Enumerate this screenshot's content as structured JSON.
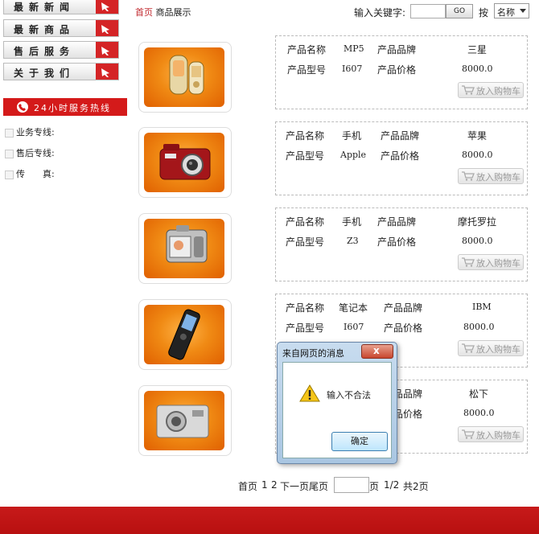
{
  "sidebar": {
    "items": [
      {
        "label": "最新新闻"
      },
      {
        "label": "最新商品"
      },
      {
        "label": "售后服务"
      },
      {
        "label": "关于我们"
      }
    ],
    "hotline": "24小时服务热线",
    "contacts": [
      {
        "label": "业务专线:"
      },
      {
        "label": "售后专线:"
      },
      {
        "label": "传　　真:"
      }
    ]
  },
  "breadcrumb": {
    "home": "首页",
    "current": "商品展示"
  },
  "search": {
    "label": "输入关键字:",
    "value": "",
    "go": "GO",
    "by": "按",
    "field_selected": "名称"
  },
  "product_labels": {
    "name": "产品名称",
    "brand": "产品品牌",
    "model": "产品型号",
    "price": "产品价格",
    "cart": "放入购物车"
  },
  "products": [
    {
      "name": "MP5",
      "brand": "三星",
      "model": "I607",
      "price": "8000.0"
    },
    {
      "name": "手机",
      "brand": "苹果",
      "model": "Apple",
      "price": "8000.0"
    },
    {
      "name": "手机",
      "brand": "摩托罗拉",
      "model": "Z3",
      "price": "8000.0"
    },
    {
      "name": "笔记本",
      "brand": "IBM",
      "model": "I607",
      "price": "8000.0"
    },
    {
      "name": "",
      "brand": "松下",
      "model": "",
      "price": "8000.0"
    }
  ],
  "pager": {
    "first": "首页",
    "page1": "1",
    "page2": "2",
    "next": "下一页",
    "last": "尾页",
    "input": "",
    "page_word": "页",
    "status": "1/2",
    "total": "共2页"
  },
  "dialog": {
    "title": "来自网页的消息",
    "close": "x",
    "message": "输入不合法",
    "ok": "确定"
  },
  "colors": {
    "accent": "#c1272d",
    "footer": "#c71a1a",
    "thumb": "#f08a14"
  }
}
